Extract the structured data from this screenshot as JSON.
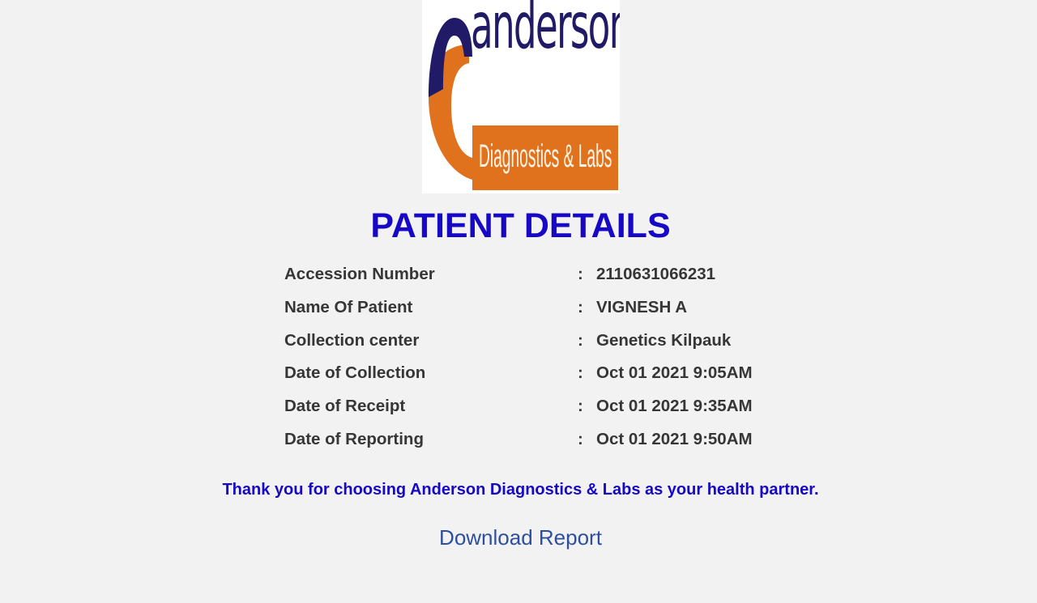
{
  "logo": {
    "wordmark": "anderson",
    "tagline": "Diagnostics & Labs",
    "colors": {
      "navy": "#211a66",
      "orange": "#e0711d"
    }
  },
  "title": "PATIENT DETAILS",
  "separator": ":",
  "details": [
    {
      "label": "Accession Number",
      "value": "2110631066231"
    },
    {
      "label": "Name Of Patient",
      "value": "VIGNESH A"
    },
    {
      "label": "Collection center",
      "value": "Genetics Kilpauk"
    },
    {
      "label": "Date of Collection",
      "value": "Oct 01 2021 9:05AM"
    },
    {
      "label": "Date of Receipt",
      "value": "Oct 01 2021 9:35AM"
    },
    {
      "label": "Date of Reporting",
      "value": "Oct 01 2021 9:50AM"
    }
  ],
  "thanks_message": "Thank you for choosing Anderson Diagnostics & Labs as your health partner.",
  "download_link": "Download Report",
  "colors": {
    "background": "#f2f2f2",
    "title": "#1608c4",
    "text": "#363636",
    "link": "#2e4fa0"
  }
}
